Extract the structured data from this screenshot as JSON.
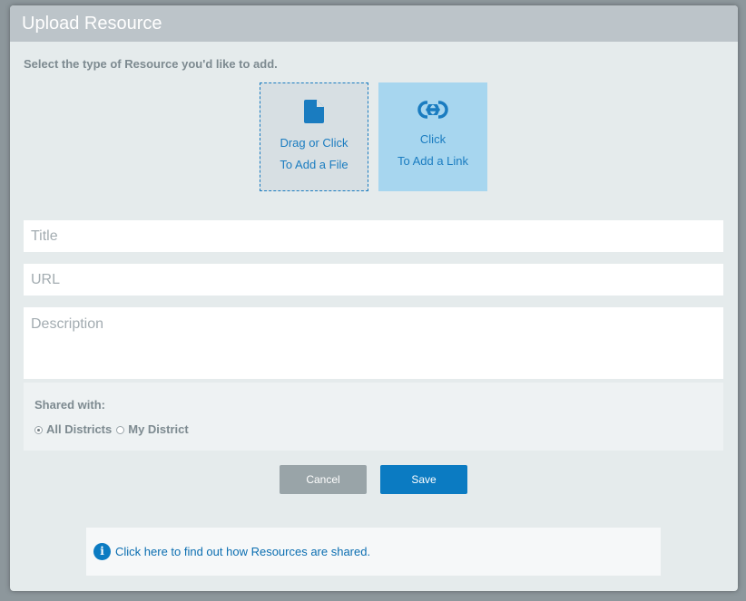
{
  "modal": {
    "title": "Upload Resource",
    "prompt": "Select the type of Resource you'd like to add.",
    "tiles": {
      "file": {
        "line1": "Drag or Click",
        "line2": "To Add a File",
        "icon": "file-icon"
      },
      "link": {
        "line1": "Click",
        "line2": "To Add a Link",
        "icon": "link-icon"
      }
    },
    "fields": {
      "title_placeholder": "Title",
      "url_placeholder": "URL",
      "description_placeholder": "Description"
    },
    "shared": {
      "label": "Shared with:",
      "options": [
        {
          "label": "All Districts",
          "checked": true
        },
        {
          "label": "My District",
          "checked": false
        }
      ]
    },
    "buttons": {
      "cancel": "Cancel",
      "save": "Save"
    },
    "info": {
      "icon": "info-icon",
      "text": "Click here to find out how Resources are shared."
    }
  },
  "colors": {
    "accent": "#0b7bc2",
    "header": "#bcc4c9",
    "cancel": "#99a4a8",
    "link_tile": "#a7d6ef"
  }
}
